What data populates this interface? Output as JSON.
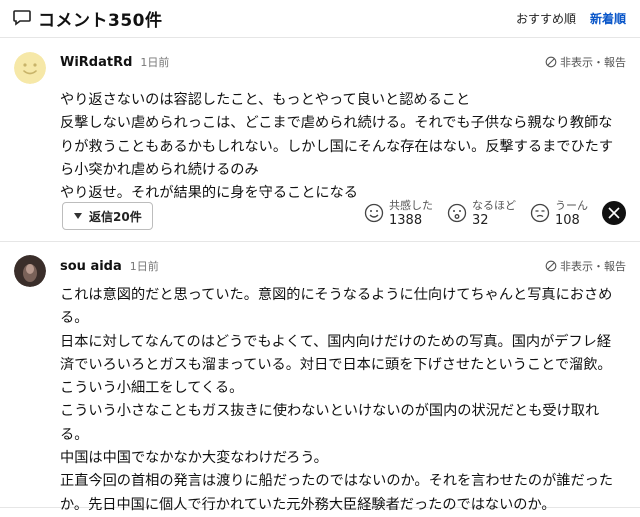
{
  "header": {
    "title": "コメント350件",
    "sort_recommended": "おすすめ順",
    "sort_newest": "新着順"
  },
  "comments": [
    {
      "username": "WiRdatRd",
      "time": "1日前",
      "hide_report": "非表示・報告",
      "lines": [
        "やり返さないのは容認したこと、もっとやって良いと認めること",
        "反撃しない虐められっこは、どこまで虐められ続ける。それでも子供なら親なり教師な",
        "りが救うこともあるかもしれない。しかし国にそんな存在はない。反撃するまでひたす",
        "ら小突かれ虐められ続けるのみ",
        "やり返せ。それが結果的に身を守ることになる"
      ],
      "reply_button": "返信20件",
      "reactions": [
        {
          "icon": "smile-face-icon",
          "label": "共感した",
          "count": "1388"
        },
        {
          "icon": "surprised-face-icon",
          "label": "なるほど",
          "count": "32"
        },
        {
          "icon": "thinking-face-icon",
          "label": "うーん",
          "count": "108"
        }
      ],
      "share_icon": "x-logo-icon"
    },
    {
      "username": "sou aida",
      "time": "1日前",
      "hide_report": "非表示・報告",
      "lines": [
        "これは意図的だと思っていた。意図的にそうなるように仕向けてちゃんと写真におさめ",
        "る。",
        "日本に対してなんてのはどうでもよくて、国内向けだけのための写真。国内がデフレ経",
        "済でいろいろとガスも溜まっている。対日で日本に頭を下げさせたということで溜飲。",
        "こういう小細工をしてくる。",
        "こういう小さなこともガス抜きに使わないといけないのが国内の状況だとも受け取れ",
        "る。",
        "中国は中国でなかなか大変なわけだろう。",
        "正直今回の首相の発言は渡りに船だったのではないのか。それを言わせたのが誰だった",
        "か。先日中国に個人で行かれていた元外務大臣経験者だったのではないのか。"
      ]
    }
  ]
}
